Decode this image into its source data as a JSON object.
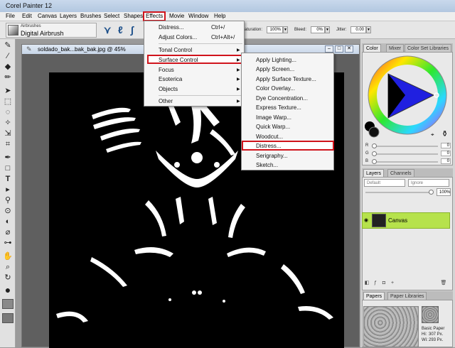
{
  "app": {
    "title": "Corel Painter 12"
  },
  "menubar": {
    "items": [
      "File",
      "Edit",
      "Canvas",
      "Layers",
      "Brushes",
      "Select",
      "Shapes",
      "Effects",
      "Movie",
      "Window",
      "Help"
    ]
  },
  "propbar": {
    "brush_category": "Airbrushes",
    "brush_name": "Digital Airbrush",
    "saturation_label": "Saturation:",
    "saturation_value": "100%",
    "bleed_label": "Bleed:",
    "bleed_value": "0%",
    "jitter_label": "Jitter:",
    "jitter_value": "0.00"
  },
  "document": {
    "title": "soldado_bak...bak_bak.jpg @ 45%"
  },
  "effects_menu": {
    "items": [
      {
        "label": "Distress...",
        "shortcut": "Ctrl+/"
      },
      {
        "label": "Adjust Colors...",
        "shortcut": "Ctrl+Alt+/"
      },
      {
        "label": "Tonal Control",
        "arrow": "▶"
      },
      {
        "label": "Surface Control",
        "arrow": "▶"
      },
      {
        "label": "Focus",
        "arrow": "▶"
      },
      {
        "label": "Esoterica",
        "arrow": "▶"
      },
      {
        "label": "Objects",
        "arrow": "▶"
      },
      {
        "label": "Other",
        "arrow": "▶"
      }
    ]
  },
  "surface_control_menu": {
    "items": [
      "Apply Lighting...",
      "Apply Screen...",
      "Apply Surface Texture...",
      "Color Overlay...",
      "Dye Concentration...",
      "Express Texture...",
      "Image Warp...",
      "Quick Warp...",
      "Woodcut...",
      "Distress...",
      "Serigraphy...",
      "Sketch..."
    ]
  },
  "color_panel": {
    "tabs": [
      "Color",
      "Mixer",
      "Color Set Libraries"
    ],
    "sliders": [
      {
        "label": "R",
        "value": "0"
      },
      {
        "label": "G",
        "value": "0"
      },
      {
        "label": "B",
        "value": "0"
      }
    ]
  },
  "layers_panel": {
    "tabs": [
      "Layers",
      "Channels"
    ],
    "composite_method": "Default",
    "preserve": "Ignore",
    "opacity": "100%",
    "layer_name": "Canvas"
  },
  "papers_panel": {
    "tabs": [
      "Papers",
      "Paper Libraries"
    ],
    "paper_name": "Basic Paper",
    "hi_label": "Hi:",
    "hi_value": "307 Px.",
    "wi_label": "Wi:",
    "wi_value": "293 Px."
  },
  "colors": {
    "highlight": "#d0141c",
    "layer_selected": "#b6e24c"
  }
}
